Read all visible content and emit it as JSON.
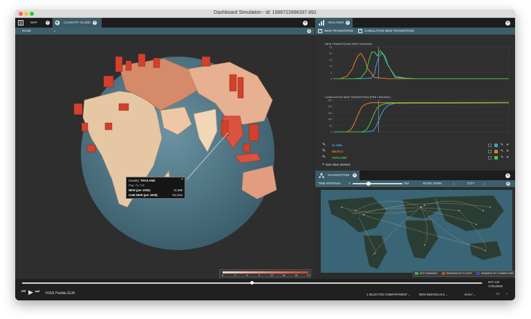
{
  "window": {
    "title": "Dashboard Simulation - id: 1566722896337.891"
  },
  "left_tabs": [
    {
      "label": "MAP"
    },
    {
      "label": "COUNTRY GLOBE"
    }
  ],
  "right_tab": {
    "label": "ANALYZER"
  },
  "globe": {
    "selector_value": "NONE",
    "tooltip": {
      "country_label": "Country:",
      "country": "THAILAND",
      "pop": "Pop: 71.7 M",
      "new_label": "NEW (per 1000):",
      "new_value": "21.599",
      "cum_label": "CUM NEW (per 1000):",
      "cum_value": "211.534"
    },
    "scale_ticks": [
      "0",
      "3",
      "6",
      "9",
      "12",
      "15",
      "18",
      "21"
    ]
  },
  "analyzer": {
    "chk_new": "NEW TRANSITIONS",
    "chk_cum": "CUMULATIVE NEW TRANSITIONS",
    "chart1_title": "NEW TRANSITIONS (PER 1000/DAY)",
    "chart2_title": "CUMULATIVE NEW TRANSITIONS (PER 1000/DAY)",
    "series": [
      {
        "name": "GLOBE",
        "color": "#3a9fe0"
      },
      {
        "name": "MEXICO",
        "color": "#e07b2a"
      },
      {
        "name": "THAILAND",
        "color": "#4cc34a"
      }
    ],
    "add_series": "ADD NEW SERIES"
  },
  "chart_data": [
    {
      "type": "line",
      "title": "NEW TRANSITIONS (PER 1000/DAY)",
      "ylim": [
        0,
        25
      ],
      "yticks": [
        "25",
        "20",
        "15",
        "10",
        "5",
        "0"
      ],
      "series": [
        {
          "name": "GLOBE",
          "x": [
            0,
            20,
            40,
            55,
            60,
            62,
            66,
            70,
            75,
            80,
            90,
            110,
            150,
            200,
            255
          ],
          "values": [
            0,
            0,
            0,
            0.5,
            4,
            10,
            17,
            20,
            18,
            10,
            2,
            0,
            0,
            0,
            0
          ]
        },
        {
          "name": "MEXICO",
          "x": [
            0,
            10,
            20,
            28,
            32,
            36,
            40,
            45,
            50,
            60,
            80,
            120,
            200,
            255
          ],
          "values": [
            0,
            0,
            2,
            8,
            14,
            18,
            20,
            16,
            8,
            1,
            0,
            0,
            0,
            0
          ]
        },
        {
          "name": "THAILAND",
          "x": [
            0,
            30,
            40,
            48,
            52,
            56,
            60,
            64,
            68,
            72,
            78,
            90,
            120,
            200,
            255
          ],
          "values": [
            0,
            0,
            0.5,
            6,
            15,
            21,
            21,
            18,
            22,
            20,
            12,
            1,
            0,
            0,
            0
          ]
        }
      ]
    },
    {
      "type": "line",
      "title": "CUMULATIVE NEW TRANSITIONS (PER 1000/DAY)",
      "ylim": [
        0,
        250
      ],
      "yticks": [
        "250",
        "200",
        "150",
        "100",
        "50",
        "0"
      ],
      "series": [
        {
          "name": "GLOBE",
          "x": [
            0,
            50,
            58,
            62,
            66,
            70,
            74,
            80,
            90,
            255
          ],
          "values": [
            0,
            0,
            10,
            40,
            90,
            140,
            180,
            210,
            225,
            228
          ]
        },
        {
          "name": "MEXICO",
          "x": [
            0,
            20,
            26,
            30,
            34,
            38,
            42,
            48,
            55,
            255
          ],
          "values": [
            0,
            0,
            20,
            60,
            110,
            160,
            200,
            220,
            230,
            232
          ]
        },
        {
          "name": "THAILAND",
          "x": [
            0,
            42,
            48,
            52,
            56,
            60,
            64,
            70,
            80,
            255
          ],
          "values": [
            0,
            0,
            15,
            50,
            100,
            150,
            190,
            215,
            225,
            228
          ]
        }
      ]
    }
  ],
  "invaded": {
    "tab": "INVADEDTREE",
    "interval_label": "TIME INTERVAL",
    "interval_start": "1",
    "interval_end": "264",
    "theme_value": "BASIC DARK",
    "level_value": "CITY",
    "legend": [
      {
        "label": "NOT INVADED",
        "color": "#4caf50"
      },
      {
        "label": "INVADED BY FLIGHT",
        "color": "#b5532a"
      },
      {
        "label": "INVADED BY COMMUTING",
        "color": "#3b4fb8"
      }
    ]
  },
  "playback": {
    "scenario": "H1N1 Puebla SLIR",
    "day": "DAY 132",
    "date": "17/01/2020",
    "progress": 0.5,
    "compartment": "1 SELECTED COMPARTMENT",
    "individuals": "NEW INDIVIDUALS",
    "frequency": "DAILY"
  }
}
